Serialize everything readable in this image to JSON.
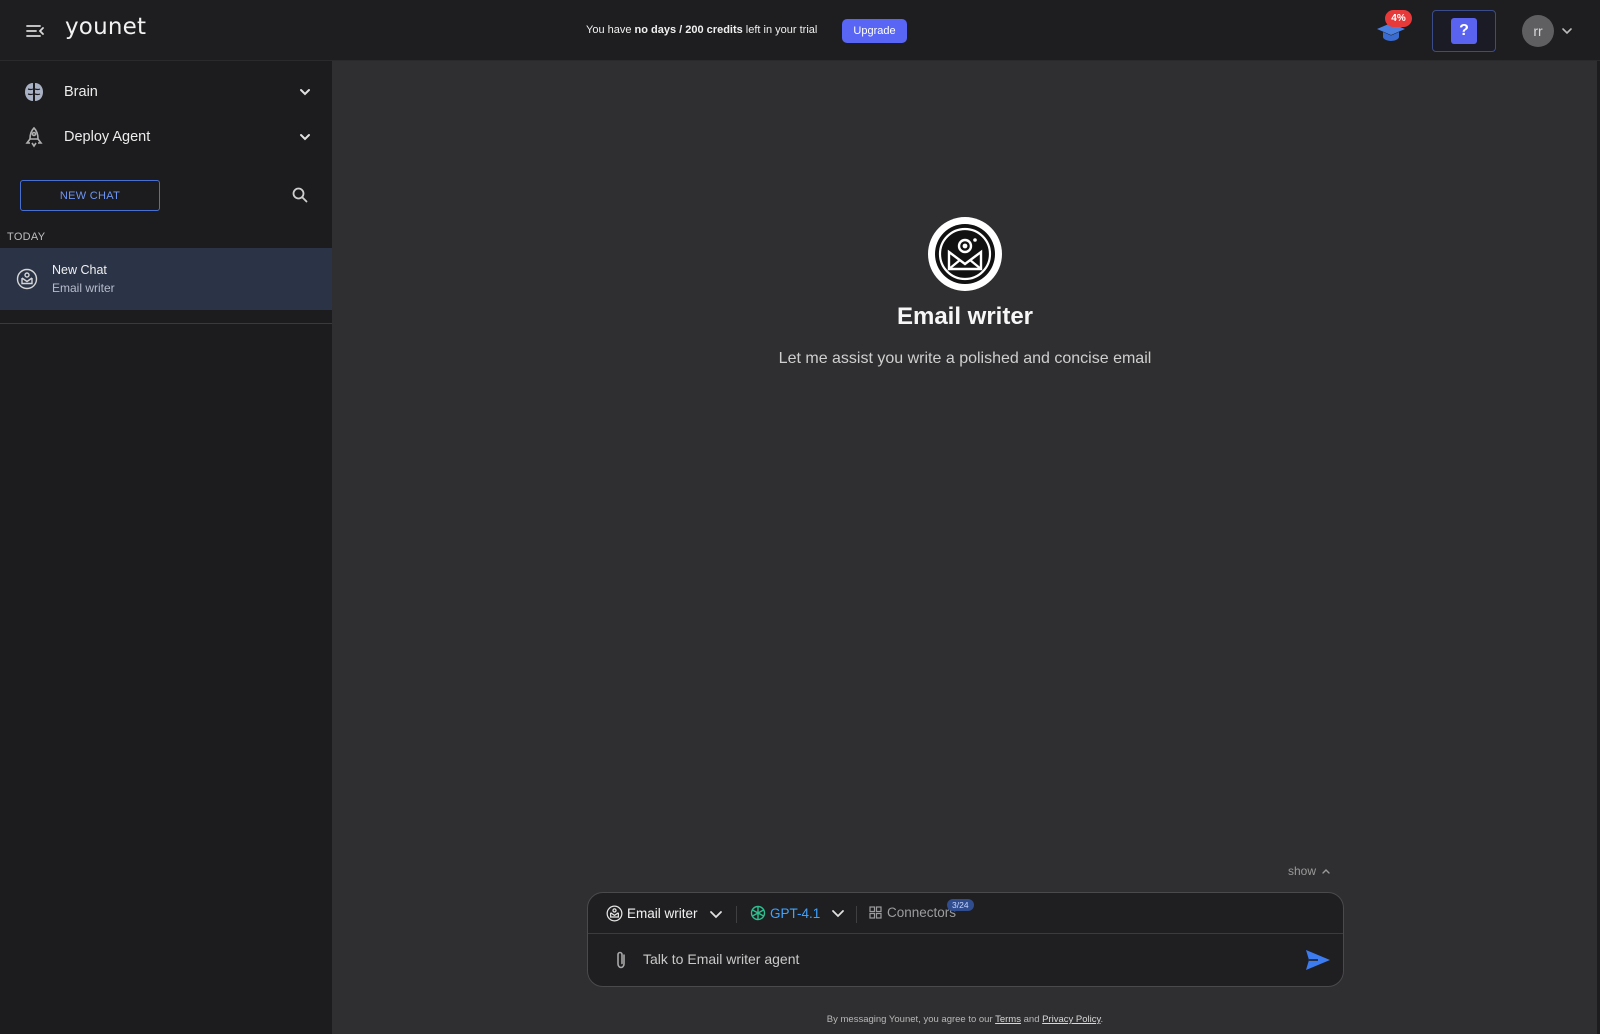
{
  "header": {
    "logo": "younet",
    "trial": {
      "prefix": "You have ",
      "bold": "no days / 200 credits",
      "suffix": " left in your trial"
    },
    "upgrade_label": "Upgrade",
    "courses_badge": "4%",
    "help_glyph": "?",
    "avatar_initials": "rr"
  },
  "sidebar": {
    "items": [
      {
        "label": "Brain",
        "icon": "brain-icon"
      },
      {
        "label": "Deploy Agent",
        "icon": "rocket-icon"
      }
    ],
    "new_chat_label": "NEW CHAT",
    "section_today": "TODAY",
    "chats": [
      {
        "title": "New Chat",
        "subtitle": "Email writer"
      }
    ]
  },
  "agent": {
    "name": "Email writer",
    "description": "Let me assist you write a polished and concise email"
  },
  "composer": {
    "show_label": "show",
    "agent_select": "Email writer",
    "model_select": "GPT-4.1",
    "connectors_label": "Connectors",
    "connectors_badge": "3/24",
    "input_placeholder": "Talk to Email writer agent"
  },
  "footer": {
    "prefix": "By messaging Younet, you agree to our ",
    "terms": "Terms",
    "and": " and ",
    "privacy": "Privacy Policy",
    "end": "."
  },
  "colors": {
    "accent": "#5865f5",
    "model": "#3fa3ff",
    "badge": "#e63a3a",
    "selected_chat": "#2b3447"
  }
}
